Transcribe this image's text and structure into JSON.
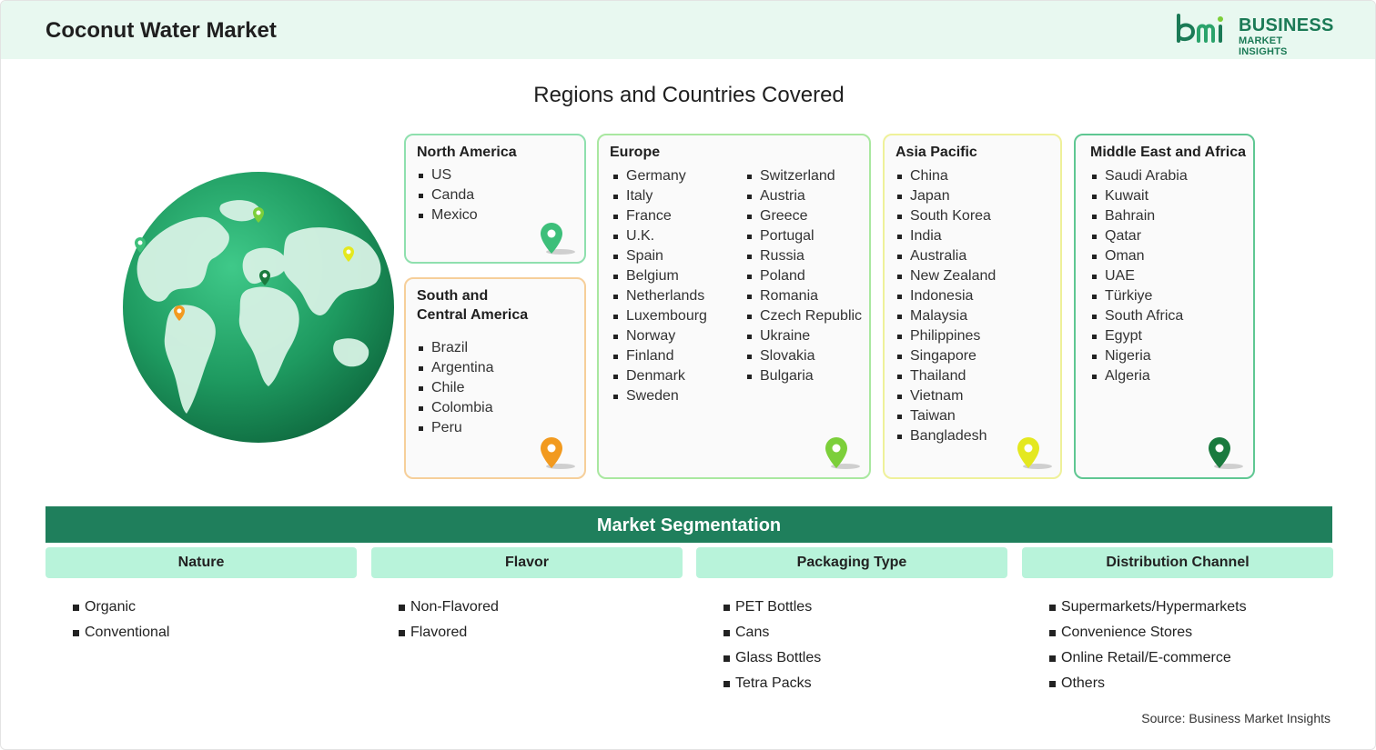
{
  "header": {
    "title": "Coconut Water Market",
    "logo_line1": "BUSINESS",
    "logo_line2": "MARKET INSIGHTS"
  },
  "regions_title": "Regions and Countries Covered",
  "regions": {
    "north_america": {
      "title": "North America",
      "countries": [
        "US",
        "Canda",
        "Mexico"
      ],
      "pin_color": "#3dbf7a"
    },
    "south_central_america": {
      "title_line1": "South and",
      "title_line2": "Central America",
      "countries": [
        "Brazil",
        "Argentina",
        "Chile",
        "Colombia",
        "Peru"
      ],
      "pin_color": "#f29a1f"
    },
    "europe": {
      "title": "Europe",
      "countries_col1": [
        "Germany",
        "Italy",
        "France",
        "U.K.",
        "Spain",
        "Belgium",
        "Netherlands",
        "Luxembourg",
        "Norway",
        "Finland",
        "Denmark",
        "Sweden"
      ],
      "countries_col2": [
        "Switzerland",
        "Austria",
        "Greece",
        "Portugal",
        "Russia",
        "Poland",
        "Romania",
        "Czech Republic",
        "Ukraine",
        "Slovakia",
        "Bulgaria"
      ],
      "pin_color": "#7ccf3a"
    },
    "asia_pacific": {
      "title": "Asia Pacific",
      "countries": [
        "China",
        "Japan",
        "South Korea",
        "India",
        "Australia",
        "New Zealand",
        "Indonesia",
        "Malaysia",
        "Philippines",
        "Singapore",
        "Thailand",
        "Vietnam",
        "Taiwan",
        "Bangladesh"
      ],
      "pin_color": "#e4e81f"
    },
    "middle_east_africa": {
      "title": "Middle East and Africa",
      "countries": [
        "Saudi Arabia",
        "Kuwait",
        "Bahrain",
        "Qatar",
        "Oman",
        "UAE",
        "Türkiye",
        "South Africa",
        "Egypt",
        "Nigeria",
        "Algeria"
      ],
      "pin_color": "#1a7a3e"
    }
  },
  "segmentation": {
    "title": "Market Segmentation",
    "columns": [
      {
        "heading": "Nature",
        "items": [
          "Organic",
          "Conventional"
        ]
      },
      {
        "heading": "Flavor",
        "items": [
          "Non-Flavored",
          "Flavored"
        ]
      },
      {
        "heading": "Packaging Type",
        "items": [
          "PET Bottles",
          "Cans",
          "Glass Bottles",
          "Tetra Packs"
        ]
      },
      {
        "heading": "Distribution Channel",
        "items": [
          "Supermarkets/Hypermarkets",
          "Convenience Stores",
          "Online Retail/E-commerce",
          "Others"
        ]
      }
    ]
  },
  "source": "Source: Business Market Insights",
  "colors": {
    "header_bg": "#e8f8f0",
    "brand_green": "#1b7a56",
    "segment_bar": "#1f7f5c",
    "segment_head": "#b8f3da"
  }
}
